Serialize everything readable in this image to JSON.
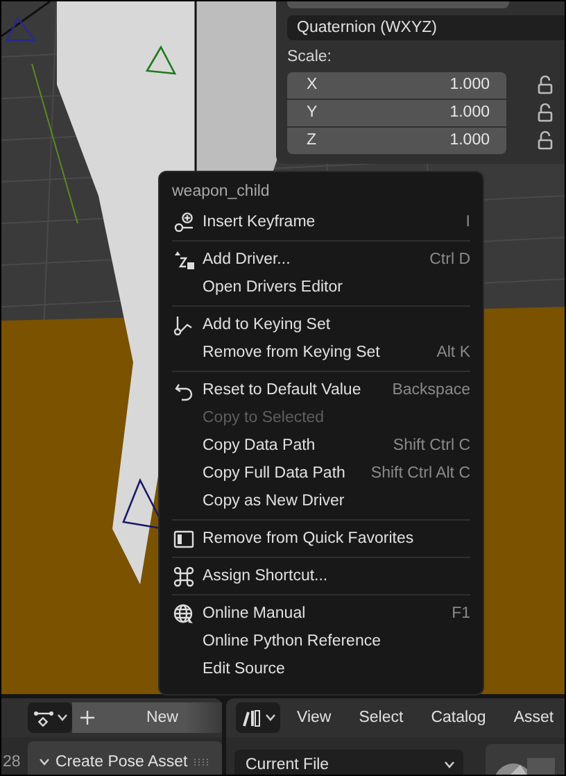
{
  "properties": {
    "rotation_mode": "Quaternion (WXYZ)",
    "scale_label": "Scale:",
    "scale": [
      {
        "axis": "X",
        "value": "1.000",
        "locked": false
      },
      {
        "axis": "Y",
        "value": "1.000",
        "locked": false
      },
      {
        "axis": "Z",
        "value": "1.000",
        "locked": false
      }
    ]
  },
  "context_menu": {
    "title": "weapon_child",
    "sections": [
      {
        "items": [
          {
            "label": "Insert Keyframe",
            "shortcut": "I",
            "disabled": false
          }
        ]
      },
      {
        "items": [
          {
            "label": "Add Driver...",
            "shortcut": "Ctrl D",
            "disabled": false
          },
          {
            "label": "Open Drivers Editor",
            "disabled": false
          }
        ]
      },
      {
        "items": [
          {
            "label": "Add to Keying Set",
            "disabled": false
          },
          {
            "label": "Remove from Keying Set",
            "shortcut": "Alt K",
            "disabled": false
          }
        ]
      },
      {
        "items": [
          {
            "label": "Reset to Default Value",
            "shortcut": "Backspace",
            "disabled": false
          },
          {
            "label": "Copy to Selected",
            "disabled": true
          },
          {
            "label": "Copy Data Path",
            "shortcut": "Shift Ctrl C",
            "disabled": false
          },
          {
            "label": "Copy Full Data Path",
            "shortcut": "Shift Ctrl Alt C",
            "disabled": false
          },
          {
            "label": "Copy as New Driver",
            "disabled": false
          }
        ]
      },
      {
        "items": [
          {
            "label": "Remove from Quick Favorites",
            "disabled": false
          }
        ]
      },
      {
        "items": [
          {
            "label": "Assign Shortcut...",
            "disabled": false
          }
        ]
      },
      {
        "items": [
          {
            "label": "Online Manual",
            "shortcut": "F1",
            "disabled": false
          },
          {
            "label": "Online Python Reference",
            "disabled": false
          },
          {
            "label": "Edit Source",
            "disabled": false
          }
        ]
      }
    ]
  },
  "pose_library": {
    "frame_number": "28",
    "new_button": "New",
    "panel_title": "Create Pose Asset"
  },
  "asset_browser": {
    "menus": [
      "View",
      "Select",
      "Catalog",
      "Asset"
    ],
    "library": "Current File"
  }
}
